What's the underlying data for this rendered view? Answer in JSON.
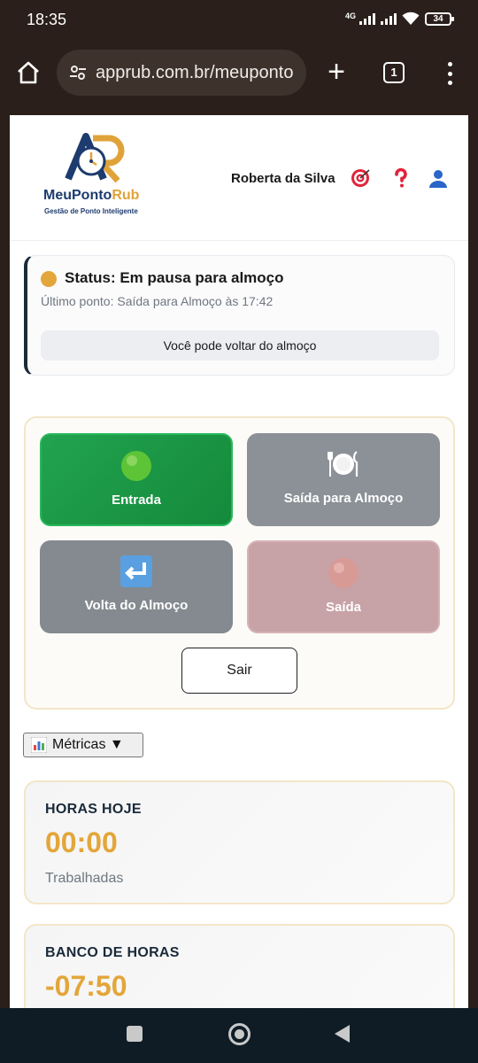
{
  "statusbar": {
    "time": "18:35",
    "network": "4G",
    "battery": "34"
  },
  "browser": {
    "url": "apprub.com.br/meuponto",
    "tab_count": "1"
  },
  "header": {
    "brand_main": "MeuPonto",
    "brand_accent": "Rub",
    "tagline": "Gestão de Ponto Inteligente",
    "user_name": "Roberta da Silva"
  },
  "status": {
    "title": "Status: Em pausa para almoço",
    "last_punch": "Último ponto: Saída para Almoço às 17:42",
    "hint": "Você pode voltar do almoço",
    "dot_color": "#e3a63a"
  },
  "punch": {
    "entrada": "Entrada",
    "saida_almoco": "Saída para Almoço",
    "volta_almoco": "Volta do Almoço",
    "saida": "Saída",
    "sair": "Sair"
  },
  "metrics": {
    "toggle_label": "Métricas ▼",
    "hoje": {
      "label": "HORAS HOJE",
      "value": "00:00",
      "sub": "Trabalhadas"
    },
    "banco": {
      "label": "BANCO DE HORAS",
      "value": "-07:50"
    }
  },
  "colors": {
    "accent": "#e3a63a",
    "brand": "#1d3b6e",
    "success": "#1f9a48"
  }
}
